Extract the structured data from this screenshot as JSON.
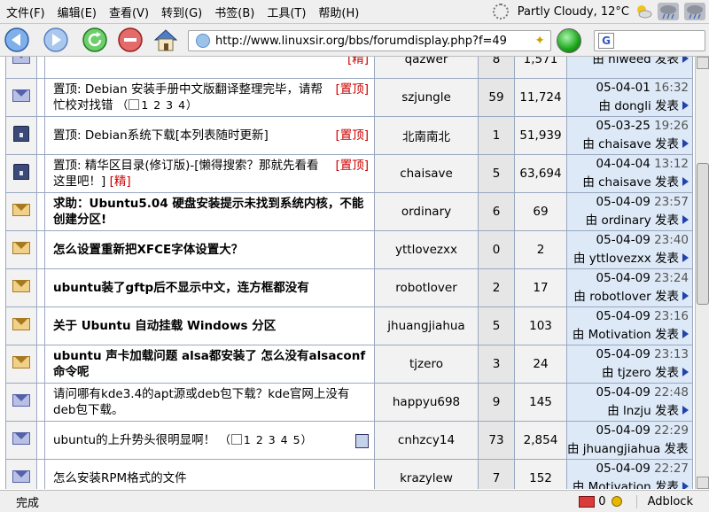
{
  "menu": [
    "文件(F)",
    "编辑(E)",
    "查看(V)",
    "转到(G)",
    "书签(B)",
    "工具(T)",
    "帮助(H)"
  ],
  "weather": {
    "text": "Partly Cloudy, 12°C"
  },
  "address": {
    "url": "http://www.linuxsir.org/bbs/forumdisplay.php?f=49"
  },
  "threads": [
    {
      "icon": "envelope-icon",
      "title": "",
      "tag": "[精]",
      "title_bold": false,
      "author": "qazwer",
      "replies": "8",
      "views": "1,571",
      "last_date": "",
      "last_time": "",
      "last_by": "由 hiweed 发表"
    },
    {
      "icon": "envelope-icon",
      "title": "置顶: Debian 安装手册中文版翻译整理完毕，请帮忙校对找错",
      "tag": "[置顶]",
      "title_bold": false,
      "pages": "1 2 3 4",
      "author": "szjungle",
      "replies": "59",
      "views": "11,724",
      "last_date": "05-04-01",
      "last_time": "16:32",
      "last_by": "由 dongli 发表"
    },
    {
      "icon": "lock-icon",
      "title": "置顶: Debian系统下载[本列表随时更新]",
      "tag": "[置顶]",
      "title_bold": false,
      "author": "北南南北",
      "replies": "1",
      "views": "51,939",
      "last_date": "05-03-25",
      "last_time": "19:26",
      "last_by": "由 chaisave 发表"
    },
    {
      "icon": "lock-icon",
      "title": "置顶: 精华区目录(修订版)-[懒得搜索？那就先看看这里吧！]",
      "tag": "[置顶]",
      "tag2": "[精]",
      "title_bold": false,
      "author": "chaisave",
      "replies": "5",
      "views": "63,694",
      "last_date": "04-04-04",
      "last_time": "13:12",
      "last_by": "由 chaisave 发表"
    },
    {
      "icon": "hot-folder-icon",
      "title": "求助：Ubuntu5.04 硬盘安装提示未找到系统内核，不能创建分区!",
      "title_bold": true,
      "author": "ordinary",
      "replies": "6",
      "views": "69",
      "last_date": "05-04-09",
      "last_time": "23:57",
      "last_by": "由 ordinary 发表"
    },
    {
      "icon": "hot-folder-icon",
      "title": "怎么设置重新把XFCE字体设置大？",
      "title_bold": true,
      "author": "yttlovezxx",
      "replies": "0",
      "views": "2",
      "last_date": "05-04-09",
      "last_time": "23:40",
      "last_by": "由 yttlovezxx 发表"
    },
    {
      "icon": "hot-folder-icon",
      "title": "ubuntu装了gftp后不显示中文，连方框都没有",
      "title_bold": true,
      "author": "robotlover",
      "replies": "2",
      "views": "17",
      "last_date": "05-04-09",
      "last_time": "23:24",
      "last_by": "由 robotlover 发表"
    },
    {
      "icon": "hot-folder-icon",
      "title": "关于 Ubuntu 自动挂载 Windows 分区",
      "title_bold": true,
      "author": "jhuangjiahua",
      "replies": "5",
      "views": "103",
      "last_date": "05-04-09",
      "last_time": "23:16",
      "last_by": "由 Motivation 发表"
    },
    {
      "icon": "hot-folder-icon",
      "title": "ubuntu 声卡加载问题 alsa都安装了 怎么没有alsaconf命令呢",
      "title_bold": true,
      "author": "tjzero",
      "replies": "3",
      "views": "24",
      "last_date": "05-04-09",
      "last_time": "23:13",
      "last_by": "由 tjzero 发表"
    },
    {
      "icon": "envelope-icon",
      "title": "请问哪有kde3.4的apt源或deb包下载？kde官网上没有deb包下载。",
      "title_bold": false,
      "author": "happyu698",
      "replies": "9",
      "views": "145",
      "last_date": "05-04-09",
      "last_time": "22:48",
      "last_by": "由 lnzju 发表"
    },
    {
      "icon": "envelope-icon",
      "title": "ubuntu的上升势头很明显啊！",
      "title_bold": false,
      "pages": "1 2 3 4 5",
      "attach": true,
      "author": "cnhzcy14",
      "replies": "73",
      "views": "2,854",
      "last_date": "05-04-09",
      "last_time": "22:29",
      "last_by": "由 jhuangjiahua 发表"
    },
    {
      "icon": "envelope-icon",
      "title": "怎么安装RPM格式的文件",
      "title_bold": false,
      "author": "krazylew",
      "replies": "7",
      "views": "152",
      "last_date": "05-04-09",
      "last_time": "22:27",
      "last_by": "由 Motivation 发表"
    }
  ],
  "status": {
    "text": "完成",
    "mail_count": "0",
    "adblock": "Adblock"
  }
}
